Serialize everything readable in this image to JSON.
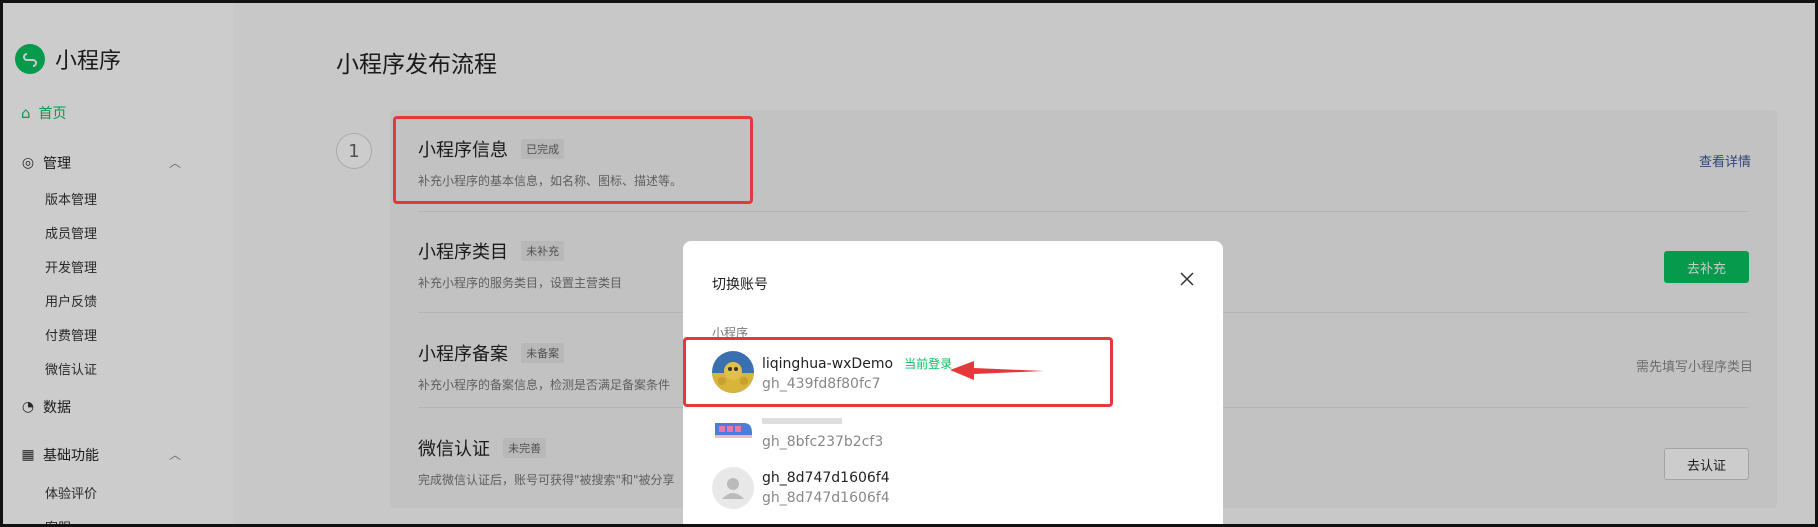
{
  "app": {
    "title": "小程序",
    "logo_icon": "mini-program-logo-icon"
  },
  "sidebar": {
    "home": "首页",
    "manage": {
      "label": "管理",
      "items": [
        "版本管理",
        "成员管理",
        "开发管理",
        "用户反馈",
        "付费管理",
        "微信认证"
      ]
    },
    "data": "数据",
    "basic": {
      "label": "基础功能",
      "items": [
        "体验评价",
        "客服"
      ]
    }
  },
  "main": {
    "title": "小程序发布流程",
    "step": "1",
    "rows": [
      {
        "title": "小程序信息",
        "tag": "已完成",
        "desc": "补充小程序的基本信息，如名称、图标、描述等。",
        "action": "查看详情"
      },
      {
        "title": "小程序类目",
        "tag": "未补充",
        "desc": "补充小程序的服务类目，设置主营类目",
        "action": "去补充"
      },
      {
        "title": "小程序备案",
        "tag": "未备案",
        "desc": "补充小程序的备案信息，检测是否满足备案条件",
        "action": "需先填写小程序类目"
      },
      {
        "title": "微信认证",
        "tag": "未完善",
        "desc": "完成微信认证后，账号可获得\"被搜索\"和\"被分享",
        "action": "去认证"
      }
    ]
  },
  "modal": {
    "title": "切换账号",
    "section": "小程序",
    "accounts": [
      {
        "name": "liqinghua-wxDemo",
        "current": "当前登录",
        "id": "gh_439fd8f80fc7"
      },
      {
        "name": "",
        "id": "gh_8bfc237b2cf3"
      },
      {
        "name": "gh_8d747d1606f4",
        "id": "gh_8d747d1606f4"
      }
    ]
  },
  "colors": {
    "accent": "#07c160",
    "annotation": "#e5383b",
    "link": "#3a5795"
  }
}
